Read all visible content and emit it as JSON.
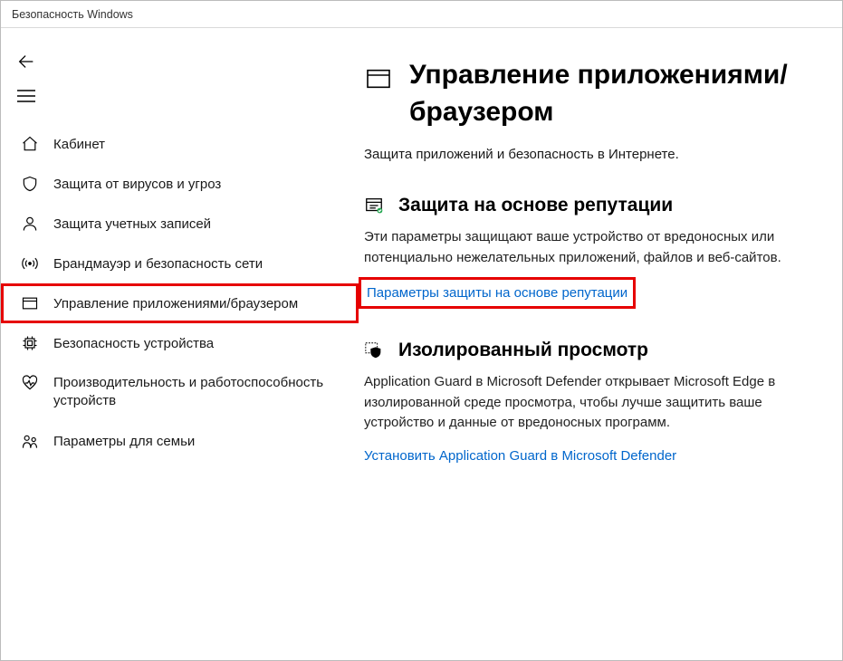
{
  "window": {
    "title": "Безопасность Windows"
  },
  "sidebar": {
    "items": [
      {
        "label": "Кабинет"
      },
      {
        "label": "Защита от вирусов и угроз"
      },
      {
        "label": "Защита учетных записей"
      },
      {
        "label": "Брандмауэр и безопасность сети"
      },
      {
        "label": "Управление приложениями/браузером"
      },
      {
        "label": "Безопасность устройства"
      },
      {
        "label": "Производительность и работоспособность устройств"
      },
      {
        "label": "Параметры для семьи"
      }
    ]
  },
  "main": {
    "title": "Управление приложениями/браузером",
    "subtitle": "Защита приложений и безопасность в Интернете.",
    "sections": [
      {
        "title": "Защита на основе репутации",
        "desc": "Эти параметры защищают ваше устройство от вредоносных или потенциально нежелательных приложений, файлов и веб-сайтов.",
        "link": "Параметры защиты на основе репутации"
      },
      {
        "title": "Изолированный просмотр",
        "desc": "Application Guard в Microsoft Defender открывает Microsoft Edge в изолированной среде просмотра, чтобы лучше защитить ваше устройство и данные от вредоносных программ.",
        "link": "Установить Application Guard в Microsoft Defender"
      }
    ]
  }
}
